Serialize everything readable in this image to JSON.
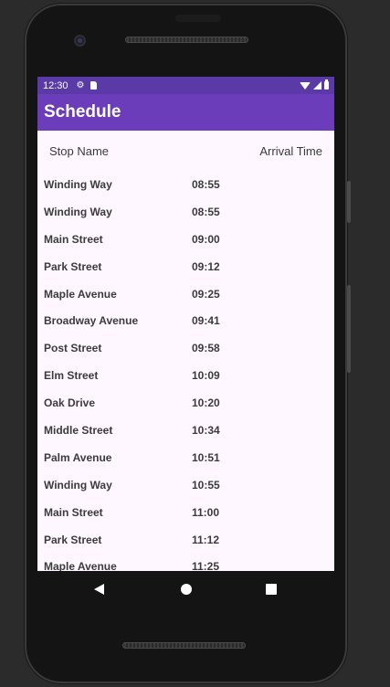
{
  "status_bar": {
    "time": "12:30",
    "icons": [
      "gear-icon",
      "sd-card-icon",
      "wifi-icon",
      "signal-icon",
      "battery-icon"
    ]
  },
  "app_bar": {
    "title": "Schedule"
  },
  "table": {
    "headers": {
      "stop_name": "Stop Name",
      "arrival_time": "Arrival Time"
    },
    "rows": [
      {
        "stop": "Winding Way",
        "time": "08:55"
      },
      {
        "stop": "Winding Way",
        "time": "08:55"
      },
      {
        "stop": "Main Street",
        "time": "09:00"
      },
      {
        "stop": "Park Street",
        "time": "09:12"
      },
      {
        "stop": "Maple Avenue",
        "time": "09:25"
      },
      {
        "stop": "Broadway Avenue",
        "time": "09:41"
      },
      {
        "stop": "Post Street",
        "time": "09:58"
      },
      {
        "stop": "Elm Street",
        "time": "10:09"
      },
      {
        "stop": "Oak Drive",
        "time": "10:20"
      },
      {
        "stop": "Middle Street",
        "time": "10:34"
      },
      {
        "stop": "Palm Avenue",
        "time": "10:51"
      },
      {
        "stop": "Winding Way",
        "time": "10:55"
      },
      {
        "stop": "Main Street",
        "time": "11:00"
      },
      {
        "stop": "Park Street",
        "time": "11:12"
      },
      {
        "stop": "Maple Avenue",
        "time": "11:25"
      }
    ]
  },
  "nav_bar": {
    "buttons": [
      "back-icon",
      "home-icon",
      "recents-icon"
    ]
  },
  "colors": {
    "status_bar_bg": "#5a3aa6",
    "app_bar_bg": "#6b3dbb",
    "screen_bg": "#fef7ff",
    "device_bg": "#141414",
    "backdrop": "#2b2b2b"
  }
}
